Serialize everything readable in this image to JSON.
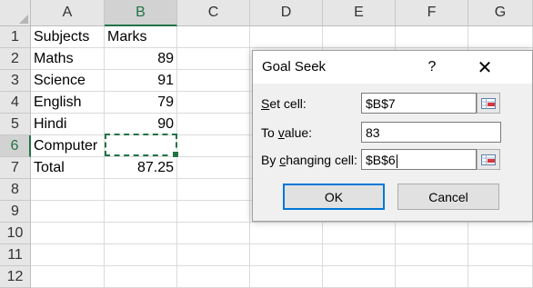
{
  "sheet": {
    "columns": [
      "A",
      "B",
      "C",
      "D",
      "E",
      "F",
      "G"
    ],
    "rows": [
      "1",
      "2",
      "3",
      "4",
      "5",
      "6",
      "7",
      "8",
      "9",
      "10",
      "11",
      "12"
    ],
    "data": [
      {
        "a": "Subjects",
        "b": "Marks"
      },
      {
        "a": "Maths",
        "b": "89"
      },
      {
        "a": "Science",
        "b": "91"
      },
      {
        "a": "English",
        "b": "79"
      },
      {
        "a": "Hindi",
        "b": "90"
      },
      {
        "a": "Computer",
        "b": ""
      },
      {
        "a": "Total",
        "b": "87.25"
      }
    ],
    "active_column": "B",
    "active_row": "6"
  },
  "dialog": {
    "title": "Goal Seek",
    "help_label": "?",
    "close_label": "✕",
    "set_cell": {
      "label_access": "S",
      "label_rest": "et cell:",
      "value": "$B$7"
    },
    "to_value": {
      "label_pre": "To ",
      "label_access": "v",
      "label_rest": "alue:",
      "value": "83"
    },
    "changing_cell": {
      "label_pre": "By ",
      "label_access": "c",
      "label_rest": "hanging cell:",
      "value": "$B$6"
    },
    "ok_label": "OK",
    "cancel_label": "Cancel",
    "accent_color": "#0078d7"
  }
}
